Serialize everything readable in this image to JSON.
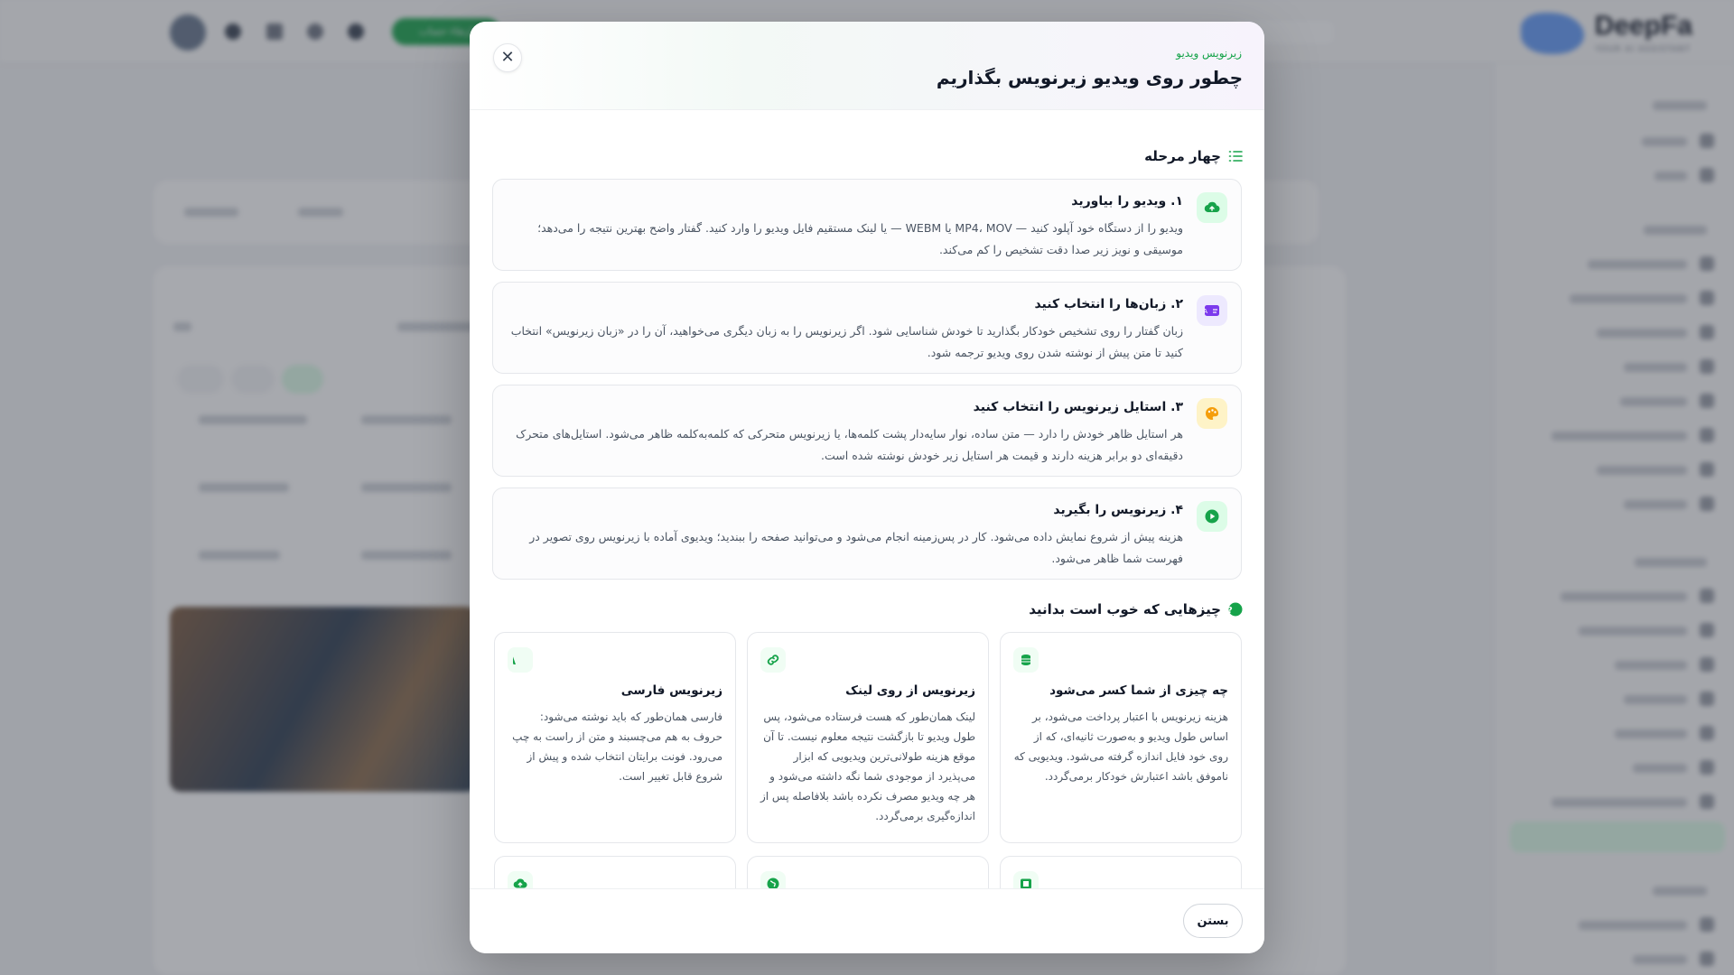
{
  "header": {
    "upgrade_label": "ارتقاء حساب"
  },
  "modal": {
    "kicker": "زیرنویس ویدیو",
    "title": "چطور روی ویدیو زیرنویس بگذاریم",
    "close_symbol": "✕",
    "steps_title": "چهار مرحله",
    "steps": [
      {
        "title": "۱. ویدیو را بیاورید",
        "desc": "ویدیو را از دستگاه خود آپلود کنید — MP4، MOV یا WEBM — یا لینک مستقیم فایل ویدیو را وارد کنید. گفتار واضح بهترین نتیجه را می‌دهد؛ موسیقی و نویز زیر صدا دقت تشخیص را کم می‌کند.",
        "icon": "cloud-upload-icon"
      },
      {
        "title": "۲. زبان‌ها را انتخاب کنید",
        "desc": "زبان گفتار را روی تشخیص خودکار بگذارید تا خودش شناسایی شود. اگر زیرنویس را به زبان دیگری می‌خواهید، آن را در «زبان زیرنویس» انتخاب کنید تا متن پیش از نوشته شدن روی ویدیو ترجمه شود.",
        "icon": "language-icon"
      },
      {
        "title": "۳. استایل زیرنویس را انتخاب کنید",
        "desc": "هر استایل ظاهر خودش را دارد — متن ساده، نوار سایه‌دار پشت کلمه‌ها، یا زیرنویس متحرکی که کلمه‌به‌کلمه ظاهر می‌شود. استایل‌های متحرک دقیقه‌ای دو برابر هزینه دارند و قیمت هر استایل زیر خودش نوشته شده است.",
        "icon": "palette-icon"
      },
      {
        "title": "۴. زیرنویس را بگیرید",
        "desc": "هزینه پیش از شروع نمایش داده می‌شود. کار در پس‌زمینه انجام می‌شود و می‌توانید صفحه را ببندید؛ ویدیوی آماده با زیرنویس روی تصویر در فهرست شما ظاهر می‌شود.",
        "icon": "play-icon"
      }
    ],
    "tips_title": "چیزهایی که خوب است بدانید",
    "cards": [
      {
        "title": "چه چیزی از شما کسر می‌شود",
        "desc": "هزینه زیرنویس با اعتبار پرداخت می‌شود، بر اساس طول ویدیو و به‌صورت ثانیه‌ای، که از روی خود فایل اندازه گرفته می‌شود. ویدیویی که ناموفق باشد اعتبارش خودکار برمی‌گردد.",
        "icon": "coins-icon"
      },
      {
        "title": "زیرنویس از روی لینک",
        "desc": "لینک همان‌طور که هست فرستاده می‌شود، پس طول ویدیو تا بازگشت نتیجه معلوم نیست. تا آن موقع هزینه طولانی‌ترین ویدیویی که ابزار می‌پذیرد از موجودی شما نگه داشته می‌شود و هر چه ویدیو مصرف نکرده باشد بلافاصله پس از اندازه‌گیری برمی‌گردد.",
        "icon": "link-icon"
      },
      {
        "title": "زیرنویس فارسی",
        "desc": "فارسی همان‌طور که باید نوشته می‌شود: حروف به هم می‌چسبند و متن از راست به چپ می‌رود. فونت برایتان انتخاب شده و پیش از شروع قابل تغییر است.",
        "icon": "letter-a-icon"
      }
    ],
    "footer_close": "بستن"
  }
}
